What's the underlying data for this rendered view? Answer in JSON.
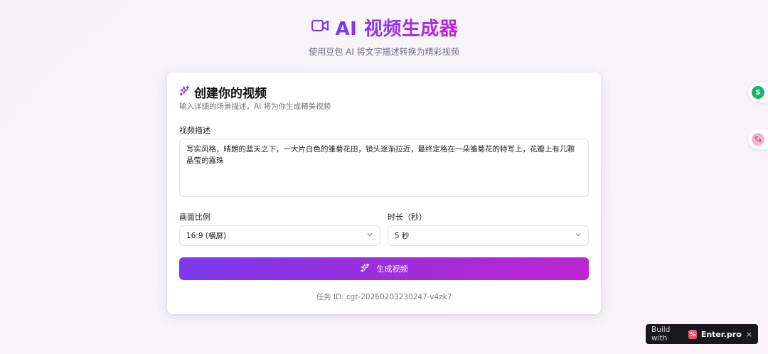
{
  "header": {
    "title": "AI 视频生成器",
    "subtitle": "使用豆包 AI 将文字描述转换为精彩视频",
    "icon": "video-camera-icon"
  },
  "card": {
    "title": "创建你的视频",
    "description": "输入详细的场景描述，AI 将为你生成精美视频",
    "icon": "sparkles-icon"
  },
  "form": {
    "description_label": "视频描述",
    "description_value": "写实风格，晴朗的蓝天之下，一大片白色的雏菊花田，镜头逐渐拉近，最终定格在一朵雏菊花的特写上，花瓣上有几颗晶莹的露珠",
    "ratio_label": "画面比例",
    "ratio_value": "16:9 (横屏)",
    "duration_label": "时长（秒）",
    "duration_value": "5 秒",
    "generate_label": "生成视频"
  },
  "task_id": "任务 ID: cgt-20260203230247-v4zk7",
  "badge": {
    "build_text": "Build with",
    "brand": "Enter.pro",
    "close": "×"
  },
  "colors": {
    "accent_start": "#7c3aed",
    "accent_end": "#c026d3"
  }
}
